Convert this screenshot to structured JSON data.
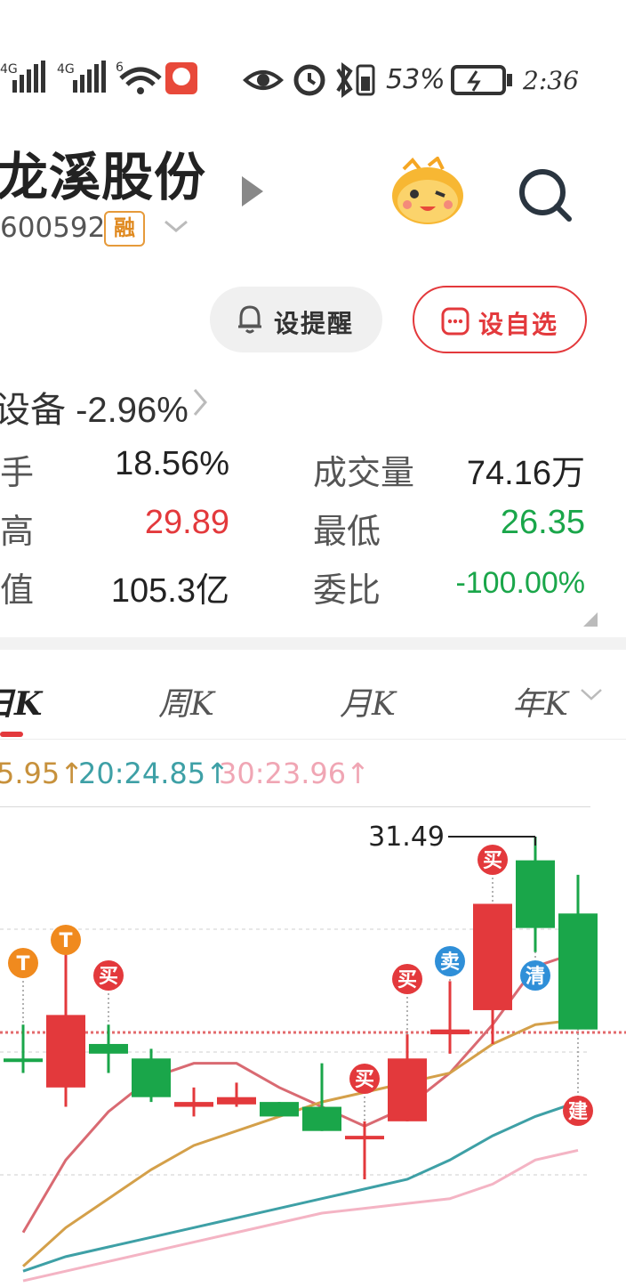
{
  "status_bar": {
    "signal1": "4G",
    "signal2": "4G",
    "wifi_badge": "6",
    "battery_percent": "53%",
    "time": "2:36",
    "icons": [
      "signal-icon",
      "signal-icon",
      "wifi-icon",
      "app-notification-icon",
      "eye-icon",
      "alarm-icon",
      "bluetooth-icon",
      "battery-small-icon",
      "battery-icon"
    ]
  },
  "header": {
    "stock_name": "龙溪股份",
    "stock_code": "600592",
    "margin_badge": "融",
    "icons": [
      "play-icon",
      "mascot-icon",
      "search-icon"
    ]
  },
  "actions": {
    "alert_label": "设提醒",
    "watchlist_label": "设自选"
  },
  "sector": {
    "text": "设备 -2.96%"
  },
  "stats": [
    {
      "label": "手",
      "value": "18.56%"
    },
    {
      "label": "成交量",
      "value": "74.16万"
    },
    {
      "label": "高",
      "value": "29.89"
    },
    {
      "label": "最低",
      "value": "26.35"
    },
    {
      "label": "值",
      "value": "105.3亿"
    },
    {
      "label": "委比",
      "value": "-100.00%"
    }
  ],
  "tabs": [
    "日K",
    "周K",
    "月K",
    "年K"
  ],
  "active_tab": "日K",
  "ma_legend": [
    {
      "text": "5.95↑",
      "color": "#c7913c"
    },
    {
      "text": "20:24.85↑",
      "color": "#3ea0a6"
    },
    {
      "text": "30:23.96↑",
      "color": "#f0a6b4"
    }
  ],
  "colors": {
    "up": "#e3393c",
    "down": "#1aa64a",
    "ma5": "#d96a72",
    "ma10": "#d4a04a",
    "ma20": "#3ea0a6",
    "ma30": "#f4b4c4"
  },
  "chart_data": {
    "type": "candlestick",
    "high_marker": "31.49",
    "candles": [
      {
        "dir": "down",
        "open": 26.9,
        "close": 26.9,
        "high": 27.6,
        "low": 26.6
      },
      {
        "dir": "up",
        "open": 26.3,
        "close": 27.8,
        "high": 29.1,
        "low": 25.9
      },
      {
        "dir": "down",
        "open": 27.2,
        "close": 27.0,
        "high": 27.6,
        "low": 26.6
      },
      {
        "dir": "down",
        "open": 26.9,
        "close": 26.1,
        "high": 27.1,
        "low": 26.0
      },
      {
        "dir": "up",
        "open": 25.9,
        "close": 26.0,
        "high": 26.3,
        "low": 25.7
      },
      {
        "dir": "up",
        "open": 25.95,
        "close": 26.1,
        "high": 26.4,
        "low": 25.9
      },
      {
        "dir": "down",
        "open": 26.0,
        "close": 25.7,
        "high": 26.0,
        "low": 25.7
      },
      {
        "dir": "down",
        "open": 25.9,
        "close": 25.4,
        "high": 26.8,
        "low": 25.4
      },
      {
        "dir": "up",
        "open": 25.3,
        "close": 25.3,
        "high": 25.6,
        "low": 24.4
      },
      {
        "dir": "up",
        "open": 25.6,
        "close": 26.9,
        "high": 27.4,
        "low": 25.6
      },
      {
        "dir": "up",
        "open": 27.4,
        "close": 27.5,
        "high": 28.5,
        "low": 27.0
      },
      {
        "dir": "up",
        "open": 27.9,
        "close": 30.1,
        "high": 30.1,
        "low": 27.2
      },
      {
        "dir": "down",
        "open": 31.0,
        "close": 29.6,
        "high": 31.49,
        "low": 29.1
      },
      {
        "dir": "down",
        "open": 29.9,
        "close": 27.5,
        "high": 30.7,
        "low": 27.5
      }
    ],
    "ma_lines": {
      "ma5": [
        23.3,
        24.8,
        25.8,
        26.5,
        26.8,
        26.8,
        26.3,
        25.9,
        25.5,
        25.9,
        26.6,
        27.6,
        28.8,
        29.1
      ],
      "ma10": [
        22.6,
        23.4,
        24.0,
        24.6,
        25.1,
        25.4,
        25.7,
        26.0,
        26.2,
        26.4,
        26.6,
        27.2,
        27.6,
        27.7
      ],
      "ma20": [
        22.5,
        22.8,
        23.0,
        23.2,
        23.4,
        23.6,
        23.8,
        24.0,
        24.2,
        24.4,
        24.8,
        25.3,
        25.7,
        26.0
      ],
      "ma30": [
        22.3,
        22.5,
        22.7,
        22.9,
        23.1,
        23.3,
        23.5,
        23.7,
        23.8,
        23.9,
        24.0,
        24.3,
        24.8,
        25.0
      ]
    },
    "signals": [
      {
        "candle": 0,
        "label": "T",
        "kind": "T"
      },
      {
        "candle": 1,
        "label": "T",
        "kind": "T"
      },
      {
        "candle": 2,
        "label": "买",
        "kind": "buy"
      },
      {
        "candle": 8,
        "label": "买",
        "kind": "buy"
      },
      {
        "candle": 9,
        "label": "买",
        "kind": "buy"
      },
      {
        "candle": 10,
        "label": "卖",
        "kind": "sell"
      },
      {
        "candle": 11,
        "label": "买",
        "kind": "buy"
      },
      {
        "candle": 12,
        "label": "清",
        "kind": "sell"
      },
      {
        "candle": 13,
        "label": "建",
        "kind": "buy"
      }
    ]
  }
}
